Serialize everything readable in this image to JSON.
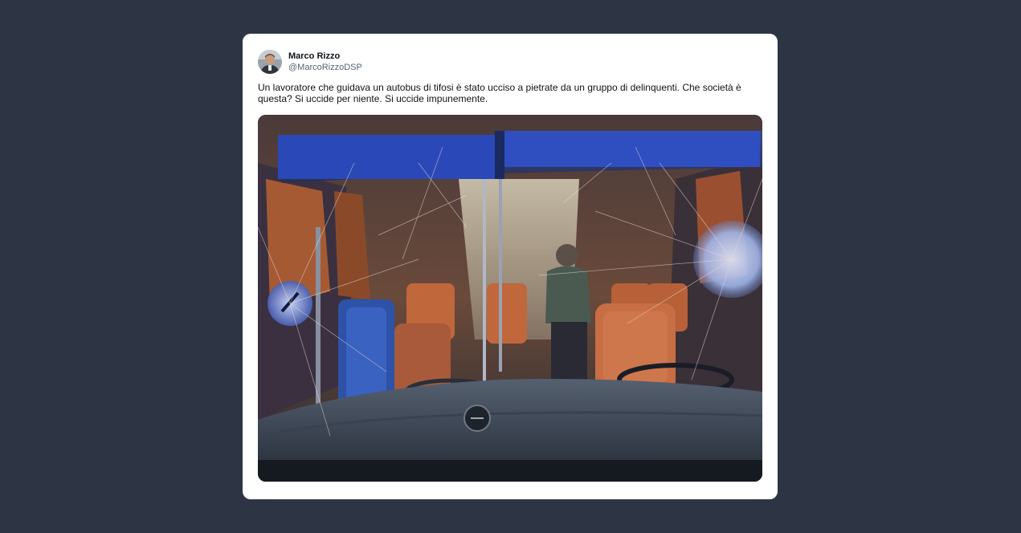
{
  "tweet": {
    "author": {
      "display_name": "Marco Rizzo",
      "handle": "@MarcoRizzoDSP",
      "avatar_icon": "user-avatar"
    },
    "text": "Un lavoratore che guidava un autobus di tifosi è stato ucciso a pietrate da un gruppo di delinquenti. Che società è questa? Si uccide per niente. Si uccide impunemente.",
    "media": {
      "kind": "photo",
      "icon": "bus-interior-photo"
    }
  },
  "colors": {
    "page_background": "#2d3544",
    "card_background": "#ffffff",
    "name_text": "#0f1419",
    "handle_text": "#536471",
    "seat_orange": "#c0673c",
    "bus_blue": "#2a48b8"
  }
}
